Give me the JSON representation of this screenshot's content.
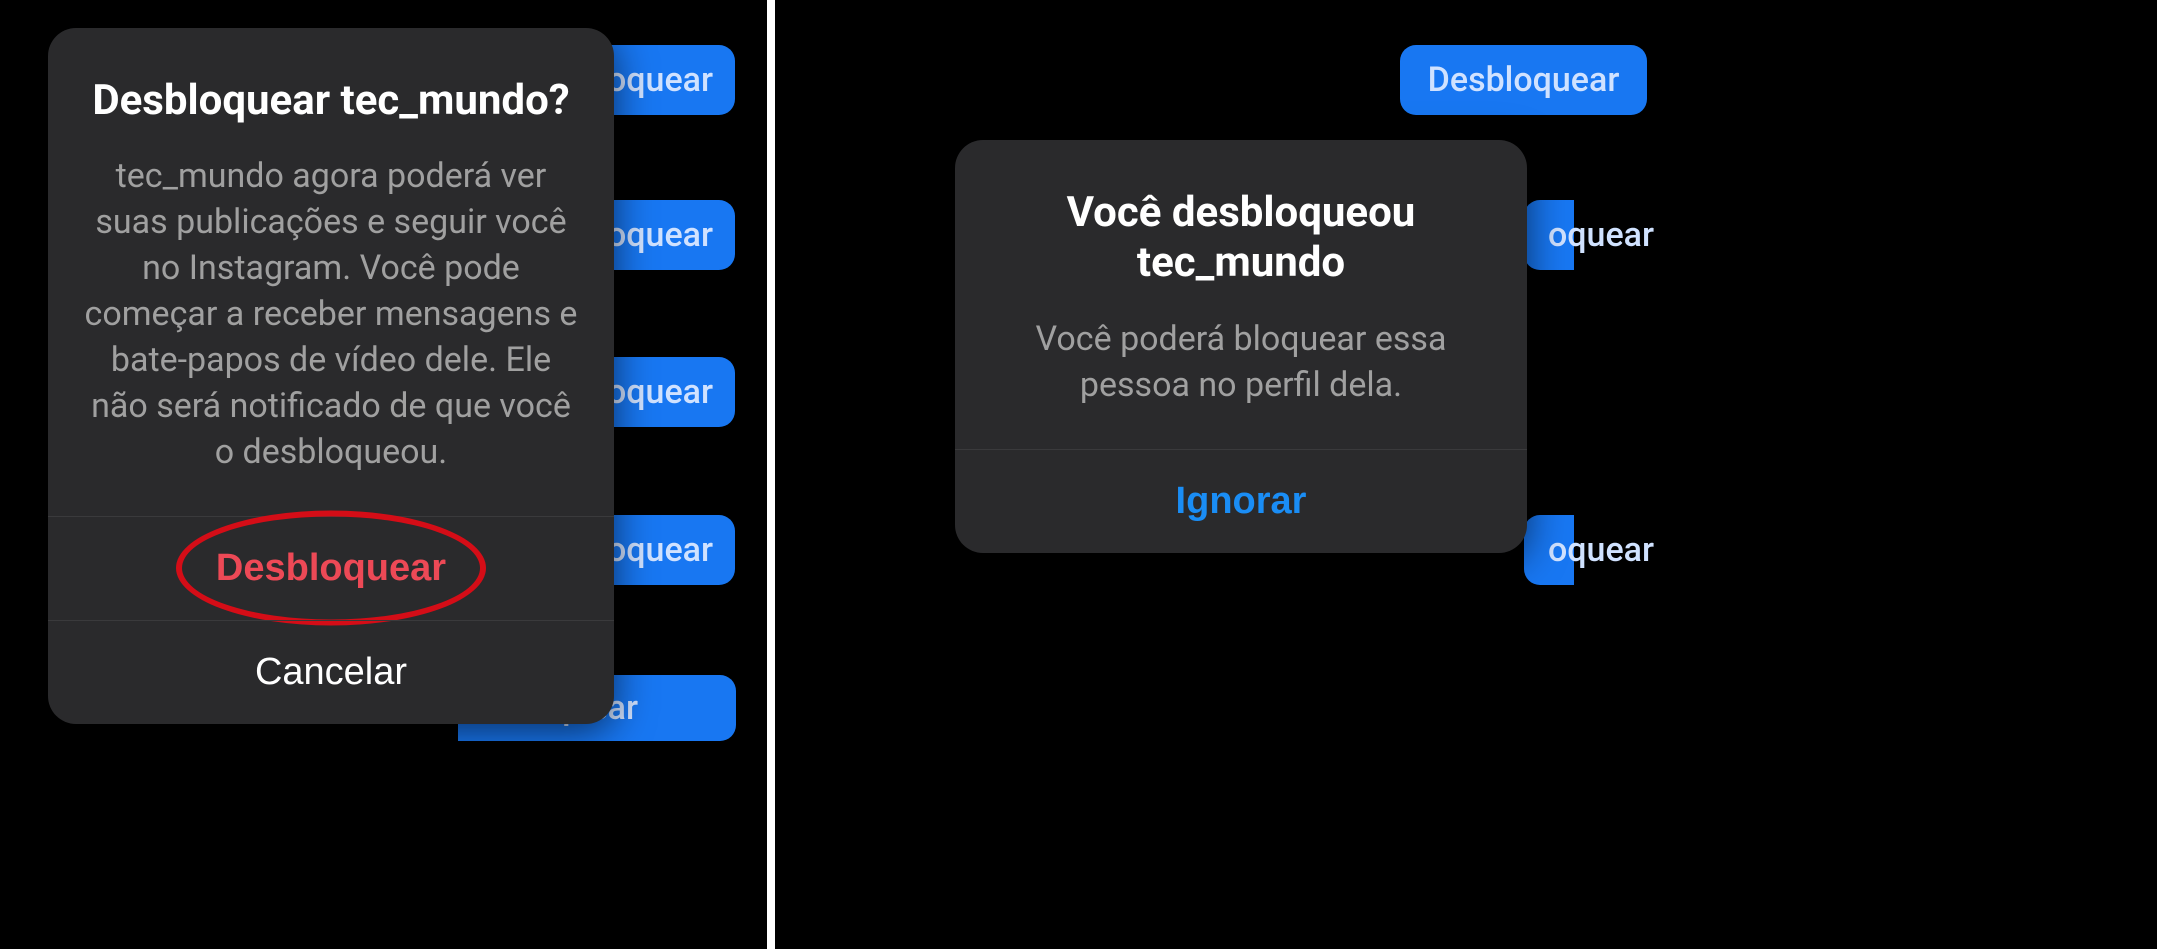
{
  "left": {
    "bg_buttons": {
      "b1": "oquear",
      "b2": "oquear",
      "b3": "oquear",
      "b4": "oquear",
      "b5": "oquear"
    },
    "dialog": {
      "title": "Desbloquear tec_mundo?",
      "body": "tec_mundo agora poderá ver suas publicações e seguir você no Instagram. Você pode começar a receber mensagens e bate-papos de vídeo dele. Ele não será notificado de que você o desbloqueou.",
      "action_unblock": "Desbloquear",
      "action_cancel": "Cancelar"
    }
  },
  "right": {
    "bg_buttons": {
      "b1": "Desbloquear",
      "b2": "oquear",
      "b3": "oquear"
    },
    "dialog": {
      "title": "Você desbloqueou tec_mundo",
      "body": "Você poderá bloquear essa pessoa no perfil dela.",
      "action_dismiss": "Ignorar"
    }
  }
}
